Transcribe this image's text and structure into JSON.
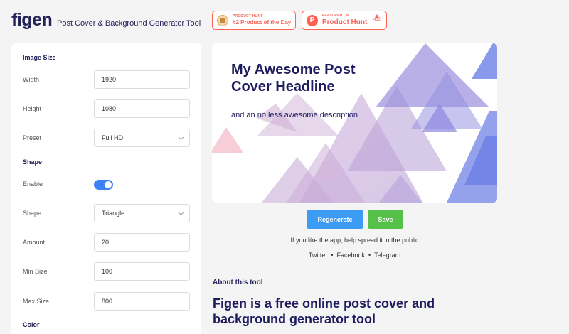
{
  "header": {
    "logo": "figen",
    "tagline": "Post Cover & Background Generator Tool"
  },
  "badges": {
    "potd": {
      "small": "PRODUCT HUNT",
      "big": "#2 Product of the Day"
    },
    "featured": {
      "small": "FEATURED ON",
      "big": "Product Hunt",
      "count": "432",
      "icon": "P"
    }
  },
  "settings": {
    "image_size_heading": "Image Size",
    "width_label": "Width",
    "width_value": "1920",
    "height_label": "Height",
    "height_value": "1080",
    "preset_label": "Preset",
    "preset_value": "Full HD",
    "shape_heading": "Shape",
    "enable_label": "Enable",
    "enable_on": true,
    "shape_label": "Shape",
    "shape_value": "Triangle",
    "amount_label": "Amount",
    "amount_value": "20",
    "min_size_label": "Min Size",
    "min_size_value": "100",
    "max_size_label": "Max Size",
    "max_size_value": "800",
    "color_heading": "Color"
  },
  "preview": {
    "headline": "My Awesome Post Cover Headline",
    "description": "and an no less awesome description"
  },
  "actions": {
    "regenerate": "Regenerate",
    "save": "Save"
  },
  "share": {
    "text": "If you like the app, help spread it in the public",
    "twitter": "Twitter",
    "facebook": "Facebook",
    "telegram": "Telegram",
    "separator": "•"
  },
  "about": {
    "heading": "About this tool",
    "title": "Figen is a free online post cover and background generator tool"
  },
  "colors": {
    "accent_blue": "#3b9bf5",
    "accent_green": "#55c04a",
    "navy": "#1e1b5e"
  }
}
